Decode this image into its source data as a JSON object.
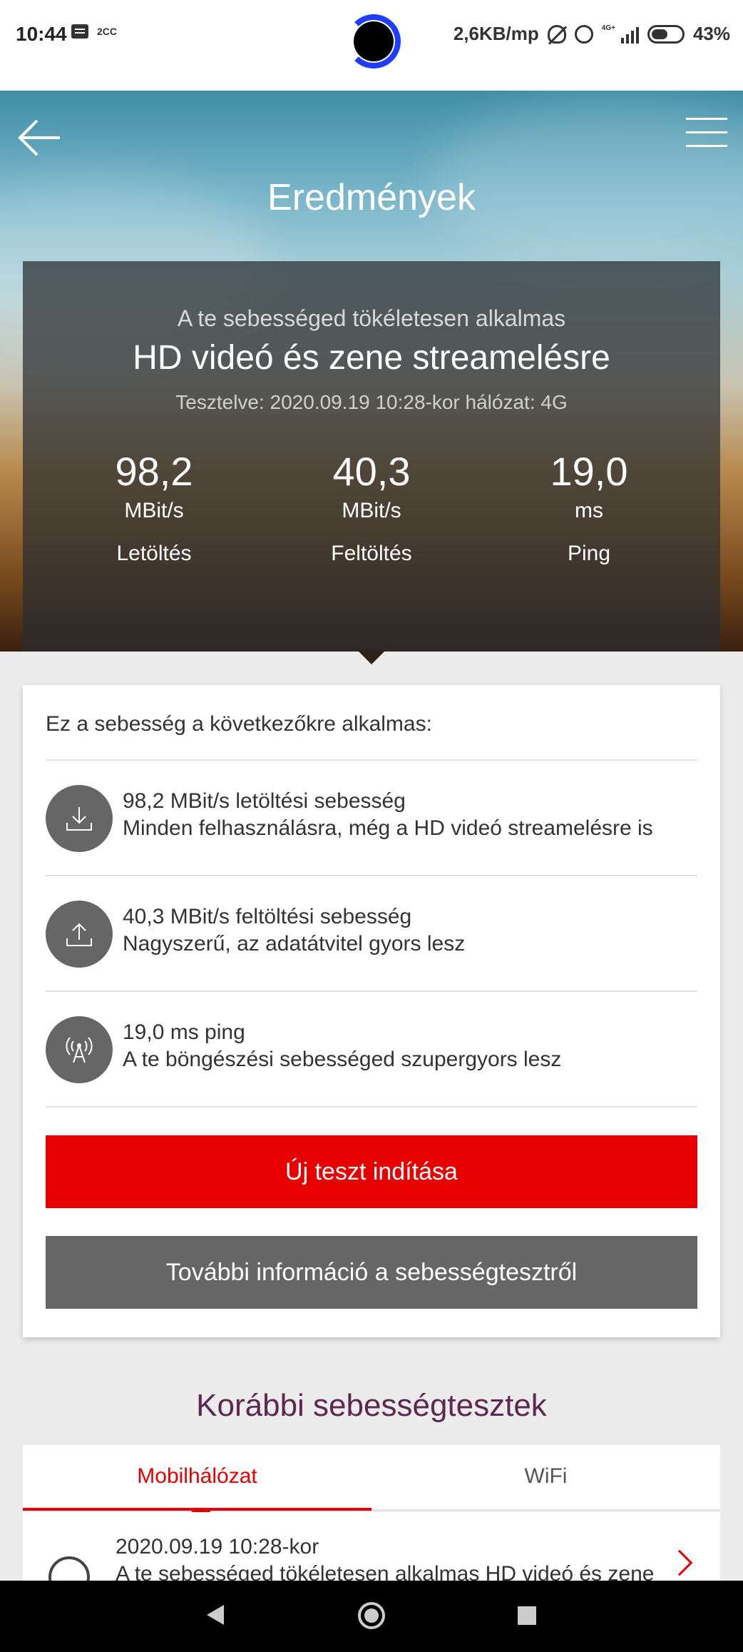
{
  "status_bar": {
    "time": "10:44",
    "small_label": "2CC",
    "speed": "2,6KB/mp",
    "network": "4G+",
    "battery": "43%"
  },
  "header": {
    "title": "Eredmények"
  },
  "result": {
    "subtitle": "A te sebességed tökéletesen alkalmas",
    "headline": "HD videó és zene streamelésre",
    "meta": "Tesztelve: 2020.09.19   10:28-kor hálózat: 4G",
    "metrics": [
      {
        "value": "98,2",
        "unit": "MBit/s",
        "label": "Letöltés"
      },
      {
        "value": "40,3",
        "unit": "MBit/s",
        "label": "Feltöltés"
      },
      {
        "value": "19,0",
        "unit": "ms",
        "label": "Ping"
      }
    ]
  },
  "suitability": {
    "title": "Ez a sebesség a következőkre alkalmas:",
    "items": [
      {
        "icon": "download-icon",
        "line1": "98,2 MBit/s letöltési sebesség",
        "line2": "Minden felhasználásra, még a HD videó streamelésre is"
      },
      {
        "icon": "upload-icon",
        "line1": "40,3 MBit/s feltöltési sebesség",
        "line2": "Nagyszerű, az adatátvitel gyors lesz"
      },
      {
        "icon": "antenna-icon",
        "line1": "19,0 ms ping",
        "line2": "A te böngészési sebességed szupergyors lesz"
      }
    ],
    "new_test_label": "Új teszt indítása",
    "more_info_label": "További információ a sebességtesztről"
  },
  "history": {
    "title": "Korábbi sebességtesztek",
    "tabs": [
      "Mobilhálózat",
      "WiFi"
    ],
    "entries": [
      {
        "date": "2020.09.19  10:28-kor",
        "text": "A te sebességed tökéletesen alkalmas HD videó és zene"
      }
    ]
  },
  "colors": {
    "accent_red": "#e60000",
    "button_grey": "#666666",
    "title_purple": "#5e2750"
  }
}
